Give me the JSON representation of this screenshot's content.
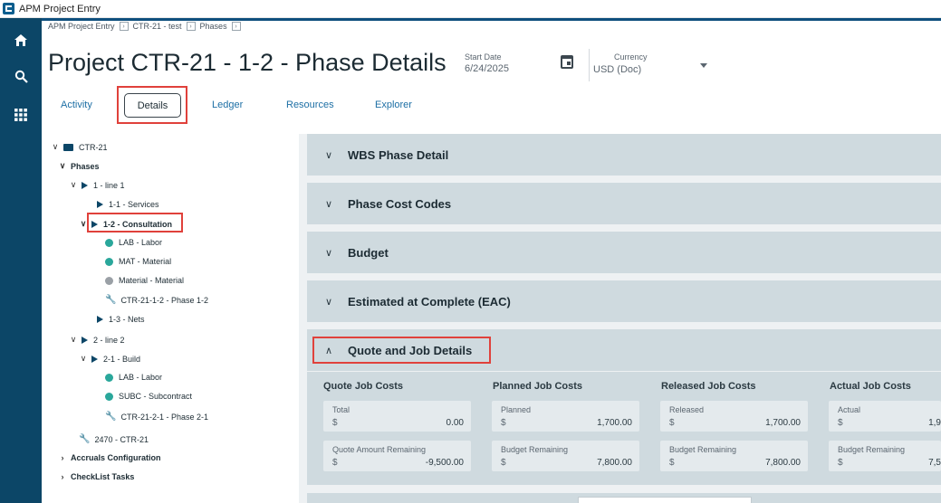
{
  "window": {
    "title": "APM Project Entry"
  },
  "rail": {
    "icons": [
      "home-icon",
      "search-icon",
      "apps-grid-icon"
    ]
  },
  "breadcrumb": [
    "APM Project Entry",
    "CTR-21 - test",
    "Phases"
  ],
  "header": {
    "title": "Project CTR-21 - 1-2 - Phase Details",
    "start_date_label": "Start Date",
    "start_date_value": "6/24/2025",
    "currency_label": "Currency",
    "currency_value": "USD (Doc)"
  },
  "tabs": [
    "Activity",
    "Details",
    "Ledger",
    "Resources",
    "Explorer"
  ],
  "active_tab": "Details",
  "tree": {
    "root": "CTR-21",
    "phases": "Phases",
    "line1": "1 - line 1",
    "services": "1-1 - Services",
    "consultation": "1-2 - Consultation",
    "lab": "LAB - Labor",
    "mat": "MAT - Material",
    "material": "Material - Material",
    "phase12": "CTR-21-1-2 - Phase 1-2",
    "nets": "1-3 - Nets",
    "line2": "2 - line 2",
    "build": "2-1 - Build",
    "lab2": "LAB - Labor",
    "subc": "SUBC - Subcontract",
    "phase21": "CTR-21-2-1 - Phase 2-1",
    "ctr2470": "2470 - CTR-21",
    "accruals": "Accruals Configuration",
    "checklist": "CheckList Tasks"
  },
  "sections": [
    "WBS Phase Detail",
    "Phase Cost Codes",
    "Budget",
    "Estimated at Complete (EAC)",
    "Quote and Job Details"
  ],
  "quote_job": {
    "columns": [
      {
        "header": "Quote Job Costs",
        "cards": [
          {
            "label": "Total",
            "currency": "$",
            "value": "0.00"
          },
          {
            "label": "Quote Amount Remaining",
            "currency": "$",
            "value": "-9,500.00"
          }
        ]
      },
      {
        "header": "Planned Job Costs",
        "cards": [
          {
            "label": "Planned",
            "currency": "$",
            "value": "1,700.00"
          },
          {
            "label": "Budget Remaining",
            "currency": "$",
            "value": "7,800.00"
          }
        ]
      },
      {
        "header": "Released Job Costs",
        "cards": [
          {
            "label": "Released",
            "currency": "$",
            "value": "1,700.00"
          },
          {
            "label": "Budget Remaining",
            "currency": "$",
            "value": "7,800.00"
          }
        ]
      },
      {
        "header": "Actual Job Costs",
        "cards": [
          {
            "label": "Actual",
            "currency": "$",
            "value": "1,9"
          },
          {
            "label": "Budget Remaining",
            "currency": "$",
            "value": "7,5"
          }
        ]
      }
    ]
  },
  "colors": {
    "rail": "#0c4667",
    "section_bg": "#cfdadf",
    "highlight": "#e0413b",
    "link": "#1d6fa5"
  }
}
